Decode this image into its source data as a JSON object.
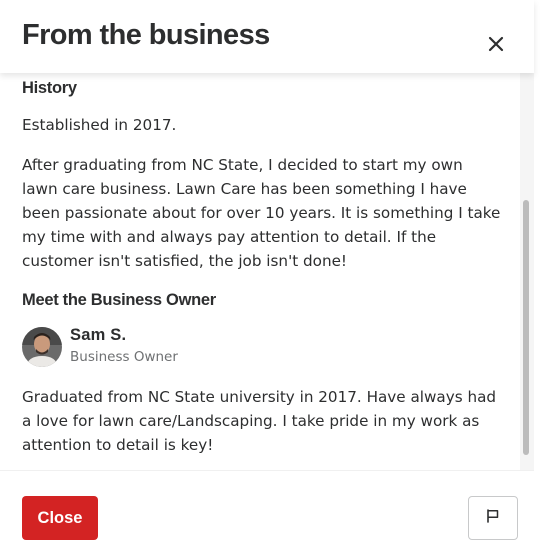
{
  "modal": {
    "title": "From the business",
    "close_icon": "close-icon",
    "flag_icon": "flag-icon",
    "close_button_label": "Close",
    "accent_color": "#d32323"
  },
  "history": {
    "heading": "History",
    "established": "Established in 2017.",
    "description": "After graduating from NC State, I decided to start my own lawn care business. Lawn Care has been something I have been passionate about for over 10 years. It is something I take my time with and always pay attention to detail. If the customer isn't satisfied, the job isn't done!"
  },
  "owner": {
    "heading": "Meet the Business Owner",
    "name": "Sam S.",
    "role": "Business Owner",
    "bio": "Graduated from NC State university in 2017. Have always had a love for lawn care/Landscaping. I take pride in my work as attention to detail is key!"
  }
}
